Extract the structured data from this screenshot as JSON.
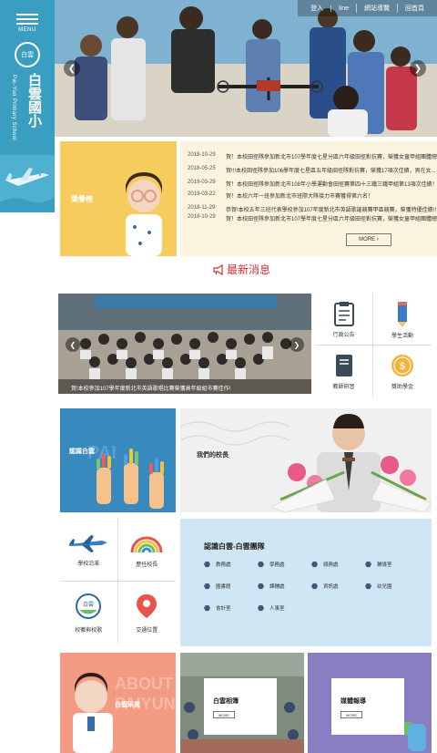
{
  "sidebar": {
    "menu_label": "MENU",
    "logo_text": "白雲",
    "name_zh": "白雲國小",
    "name_en": "Pai-Yun Primary School"
  },
  "hero": {
    "topnav": [
      "登入",
      "line",
      "網站導覽",
      "回首頁"
    ]
  },
  "honor": {
    "label": "榮譽榜",
    "items": [
      {
        "date": "2018-10-29",
        "text": "賀！本校田徑隊參加新北市107學年度七星分區六年級田徑對抗賽，榮獲女童甲組團體總"
      },
      {
        "date": "2018-05-25",
        "text": "賀!!!本校田徑隊參加106學年度七星區五年級田徑隊對抗賽，榮獲17項次佳績，男在女..."
      },
      {
        "date": "2019-03-29",
        "text": "賀！本校田徑隊參加新北市108年小學運動會田徑賽第四十三鐵三鐵甲組第13項次佳績！..."
      },
      {
        "date": "2019-03-22",
        "text": "賀！本校六年一班參加新北市班際大隊接力市賽獲得第六名！"
      },
      {
        "date": "2018-11-29",
        "text": "恭賀!本校五年三班代表學校參加107年度新北市英語歌謠競賽甲區競賽，榮獲特優佳績!!"
      },
      {
        "date": "2018-10-29",
        "text": "賀！本校田徑隊參加新北市107學年度七星分區六年級田徑對抗賽，榮獲女童甲組團體總"
      }
    ],
    "more": "MORE"
  },
  "news": {
    "title": "最新消息",
    "caption": "賀!本校參加107學年度新北市英語歌唱比賽榮獲高年級組市賽佳作!"
  },
  "quick_links": [
    "行政公告",
    "學生活動",
    "教師研習",
    "獎助學金"
  ],
  "about": {
    "label": "認識白雲",
    "principal": "我們的校長"
  },
  "features": [
    "學校沿革",
    "歷任校長",
    "校徽與校歌",
    "交通位置"
  ],
  "team": {
    "title": "認識白雲-白雲團隊",
    "items": [
      "教務處",
      "學務處",
      "總務處",
      "輔導室",
      "圖書館",
      "課輔處",
      "資訊處",
      "幼兒園",
      "會計室",
      "人事室"
    ]
  },
  "bottom": {
    "card1": "白雲采風",
    "card2": "白雲相簿",
    "card3": "媒體報導",
    "more": "MORE"
  },
  "colors": {
    "sidebar": "#3a9ec0",
    "honor_yellow": "#f6cc5d",
    "news_red": "#c8323a",
    "about_blue": "#3889bd",
    "team_bg": "#cfe7f4",
    "coral": "#f39a82",
    "purple": "#8a7ec2"
  }
}
